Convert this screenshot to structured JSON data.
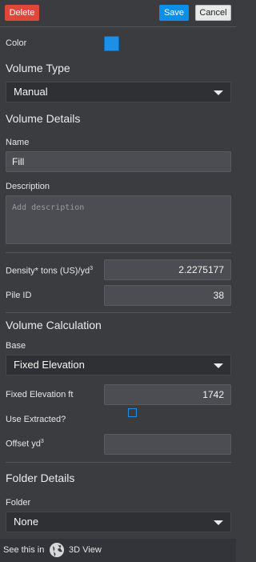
{
  "toolbar": {
    "delete_label": "Delete",
    "save_label": "Save",
    "cancel_label": "Cancel"
  },
  "color": {
    "label": "Color",
    "swatch": "#1d8fe6"
  },
  "volume_type": {
    "heading": "Volume Type",
    "selected": "Manual"
  },
  "volume_details": {
    "heading": "Volume Details",
    "name_label": "Name",
    "name_value": "Fill",
    "description_label": "Description",
    "description_placeholder": "Add description",
    "density_label": "Density* tons (US)/yd",
    "density_sup": "3",
    "density_value": "2.2275177",
    "pile_id_label": "Pile ID",
    "pile_id_value": "38"
  },
  "volume_calculation": {
    "heading": "Volume Calculation",
    "base_label": "Base",
    "base_selected": "Fixed Elevation",
    "fixed_elevation_label": "Fixed Elevation ft",
    "fixed_elevation_value": "1742",
    "use_extracted_label": "Use Extracted?",
    "offset_label": "Offset yd",
    "offset_sup": "3",
    "offset_value": ""
  },
  "folder_details": {
    "heading": "Folder Details",
    "folder_label": "Folder",
    "folder_selected": "None"
  },
  "footer": {
    "see_this_in": "See this in",
    "view_label": "3D View"
  }
}
